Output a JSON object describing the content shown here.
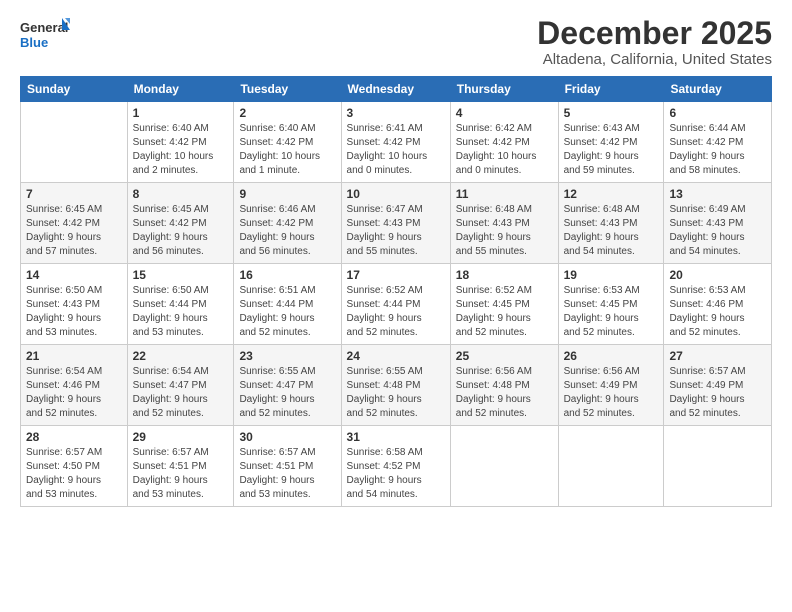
{
  "logo": {
    "line1": "General",
    "line2": "Blue"
  },
  "header": {
    "title": "December 2025",
    "location": "Altadena, California, United States"
  },
  "weekdays": [
    "Sunday",
    "Monday",
    "Tuesday",
    "Wednesday",
    "Thursday",
    "Friday",
    "Saturday"
  ],
  "weeks": [
    [
      {
        "day": "",
        "info": ""
      },
      {
        "day": "1",
        "info": "Sunrise: 6:40 AM\nSunset: 4:42 PM\nDaylight: 10 hours\nand 2 minutes."
      },
      {
        "day": "2",
        "info": "Sunrise: 6:40 AM\nSunset: 4:42 PM\nDaylight: 10 hours\nand 1 minute."
      },
      {
        "day": "3",
        "info": "Sunrise: 6:41 AM\nSunset: 4:42 PM\nDaylight: 10 hours\nand 0 minutes."
      },
      {
        "day": "4",
        "info": "Sunrise: 6:42 AM\nSunset: 4:42 PM\nDaylight: 10 hours\nand 0 minutes."
      },
      {
        "day": "5",
        "info": "Sunrise: 6:43 AM\nSunset: 4:42 PM\nDaylight: 9 hours\nand 59 minutes."
      },
      {
        "day": "6",
        "info": "Sunrise: 6:44 AM\nSunset: 4:42 PM\nDaylight: 9 hours\nand 58 minutes."
      }
    ],
    [
      {
        "day": "7",
        "info": "Sunrise: 6:45 AM\nSunset: 4:42 PM\nDaylight: 9 hours\nand 57 minutes."
      },
      {
        "day": "8",
        "info": "Sunrise: 6:45 AM\nSunset: 4:42 PM\nDaylight: 9 hours\nand 56 minutes."
      },
      {
        "day": "9",
        "info": "Sunrise: 6:46 AM\nSunset: 4:42 PM\nDaylight: 9 hours\nand 56 minutes."
      },
      {
        "day": "10",
        "info": "Sunrise: 6:47 AM\nSunset: 4:43 PM\nDaylight: 9 hours\nand 55 minutes."
      },
      {
        "day": "11",
        "info": "Sunrise: 6:48 AM\nSunset: 4:43 PM\nDaylight: 9 hours\nand 55 minutes."
      },
      {
        "day": "12",
        "info": "Sunrise: 6:48 AM\nSunset: 4:43 PM\nDaylight: 9 hours\nand 54 minutes."
      },
      {
        "day": "13",
        "info": "Sunrise: 6:49 AM\nSunset: 4:43 PM\nDaylight: 9 hours\nand 54 minutes."
      }
    ],
    [
      {
        "day": "14",
        "info": "Sunrise: 6:50 AM\nSunset: 4:43 PM\nDaylight: 9 hours\nand 53 minutes."
      },
      {
        "day": "15",
        "info": "Sunrise: 6:50 AM\nSunset: 4:44 PM\nDaylight: 9 hours\nand 53 minutes."
      },
      {
        "day": "16",
        "info": "Sunrise: 6:51 AM\nSunset: 4:44 PM\nDaylight: 9 hours\nand 52 minutes."
      },
      {
        "day": "17",
        "info": "Sunrise: 6:52 AM\nSunset: 4:44 PM\nDaylight: 9 hours\nand 52 minutes."
      },
      {
        "day": "18",
        "info": "Sunrise: 6:52 AM\nSunset: 4:45 PM\nDaylight: 9 hours\nand 52 minutes."
      },
      {
        "day": "19",
        "info": "Sunrise: 6:53 AM\nSunset: 4:45 PM\nDaylight: 9 hours\nand 52 minutes."
      },
      {
        "day": "20",
        "info": "Sunrise: 6:53 AM\nSunset: 4:46 PM\nDaylight: 9 hours\nand 52 minutes."
      }
    ],
    [
      {
        "day": "21",
        "info": "Sunrise: 6:54 AM\nSunset: 4:46 PM\nDaylight: 9 hours\nand 52 minutes."
      },
      {
        "day": "22",
        "info": "Sunrise: 6:54 AM\nSunset: 4:47 PM\nDaylight: 9 hours\nand 52 minutes."
      },
      {
        "day": "23",
        "info": "Sunrise: 6:55 AM\nSunset: 4:47 PM\nDaylight: 9 hours\nand 52 minutes."
      },
      {
        "day": "24",
        "info": "Sunrise: 6:55 AM\nSunset: 4:48 PM\nDaylight: 9 hours\nand 52 minutes."
      },
      {
        "day": "25",
        "info": "Sunrise: 6:56 AM\nSunset: 4:48 PM\nDaylight: 9 hours\nand 52 minutes."
      },
      {
        "day": "26",
        "info": "Sunrise: 6:56 AM\nSunset: 4:49 PM\nDaylight: 9 hours\nand 52 minutes."
      },
      {
        "day": "27",
        "info": "Sunrise: 6:57 AM\nSunset: 4:49 PM\nDaylight: 9 hours\nand 52 minutes."
      }
    ],
    [
      {
        "day": "28",
        "info": "Sunrise: 6:57 AM\nSunset: 4:50 PM\nDaylight: 9 hours\nand 53 minutes."
      },
      {
        "day": "29",
        "info": "Sunrise: 6:57 AM\nSunset: 4:51 PM\nDaylight: 9 hours\nand 53 minutes."
      },
      {
        "day": "30",
        "info": "Sunrise: 6:57 AM\nSunset: 4:51 PM\nDaylight: 9 hours\nand 53 minutes."
      },
      {
        "day": "31",
        "info": "Sunrise: 6:58 AM\nSunset: 4:52 PM\nDaylight: 9 hours\nand 54 minutes."
      },
      {
        "day": "",
        "info": ""
      },
      {
        "day": "",
        "info": ""
      },
      {
        "day": "",
        "info": ""
      }
    ]
  ]
}
